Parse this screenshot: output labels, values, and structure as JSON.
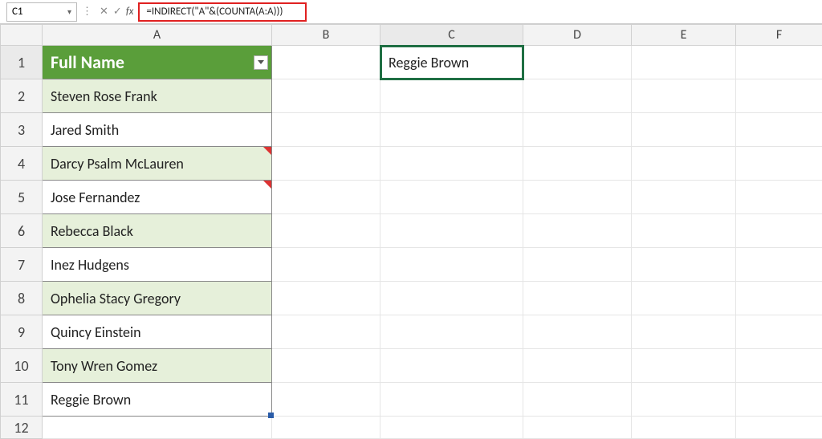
{
  "name_box": "C1",
  "formula": "=INDIRECT(\"A\"&(COUNTA(A:A)))",
  "columns": [
    "",
    "A",
    "B",
    "C",
    "D",
    "E",
    "F"
  ],
  "header_cell": "Full Name",
  "col_a_values": [
    "Steven Rose Frank",
    "Jared  Smith",
    "Darcy Psalm McLauren",
    "Jose  Fernandez",
    "Rebecca  Black",
    "Inez  Hudgens",
    "Ophelia Stacy Gregory",
    "Quincy  Einstein",
    "Tony Wren Gomez",
    "Reggie  Brown"
  ],
  "c1_value": "Reggie  Brown",
  "rows_shown": [
    "1",
    "2",
    "3",
    "4",
    "5",
    "6",
    "7",
    "8",
    "9",
    "10",
    "11",
    "12"
  ],
  "selected_cell": "C1",
  "highlight_formula": true
}
